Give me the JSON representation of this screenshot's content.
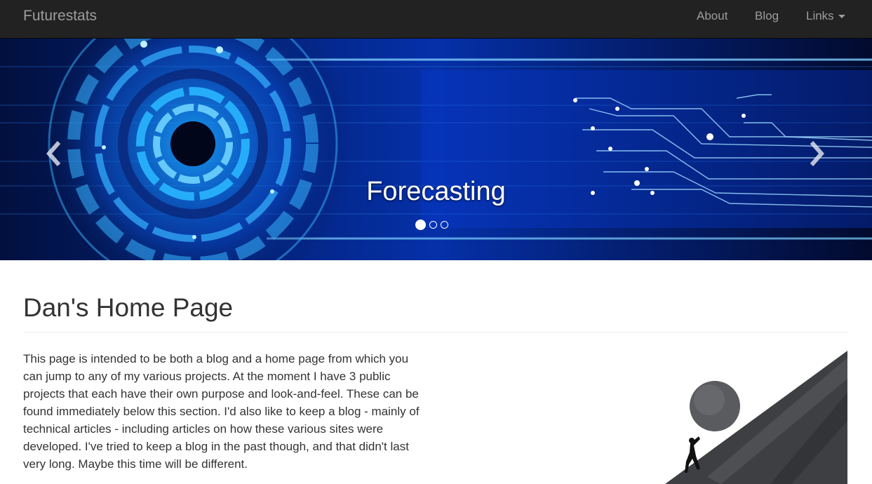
{
  "navbar": {
    "brand": "Futurestats",
    "items": [
      {
        "label": "About"
      },
      {
        "label": "Blog"
      },
      {
        "label": "Links"
      }
    ]
  },
  "carousel": {
    "caption": "Forecasting",
    "slide_count": 3,
    "active_index": 0,
    "prev_icon": "chevron-left-icon",
    "next_icon": "chevron-right-icon"
  },
  "main": {
    "title": "Dan's Home Page",
    "intro": "This page is intended to be both a blog and a home page from which you can jump to any of my various projects. At the moment I have 3 public projects that each have their own purpose and look-and-feel. These can be found immediately below this section. I'd also like to keep a blog - mainly of technical articles - including articles on how these various sites were developed. I've tried to keep a blog in the past though, and that didn't last very long. Maybe this time will be different."
  },
  "colors": {
    "navbar_bg": "#222222",
    "nav_text": "#9d9d9d",
    "carousel_bg": "#020a2e",
    "accent_blue": "#1e9bff"
  }
}
